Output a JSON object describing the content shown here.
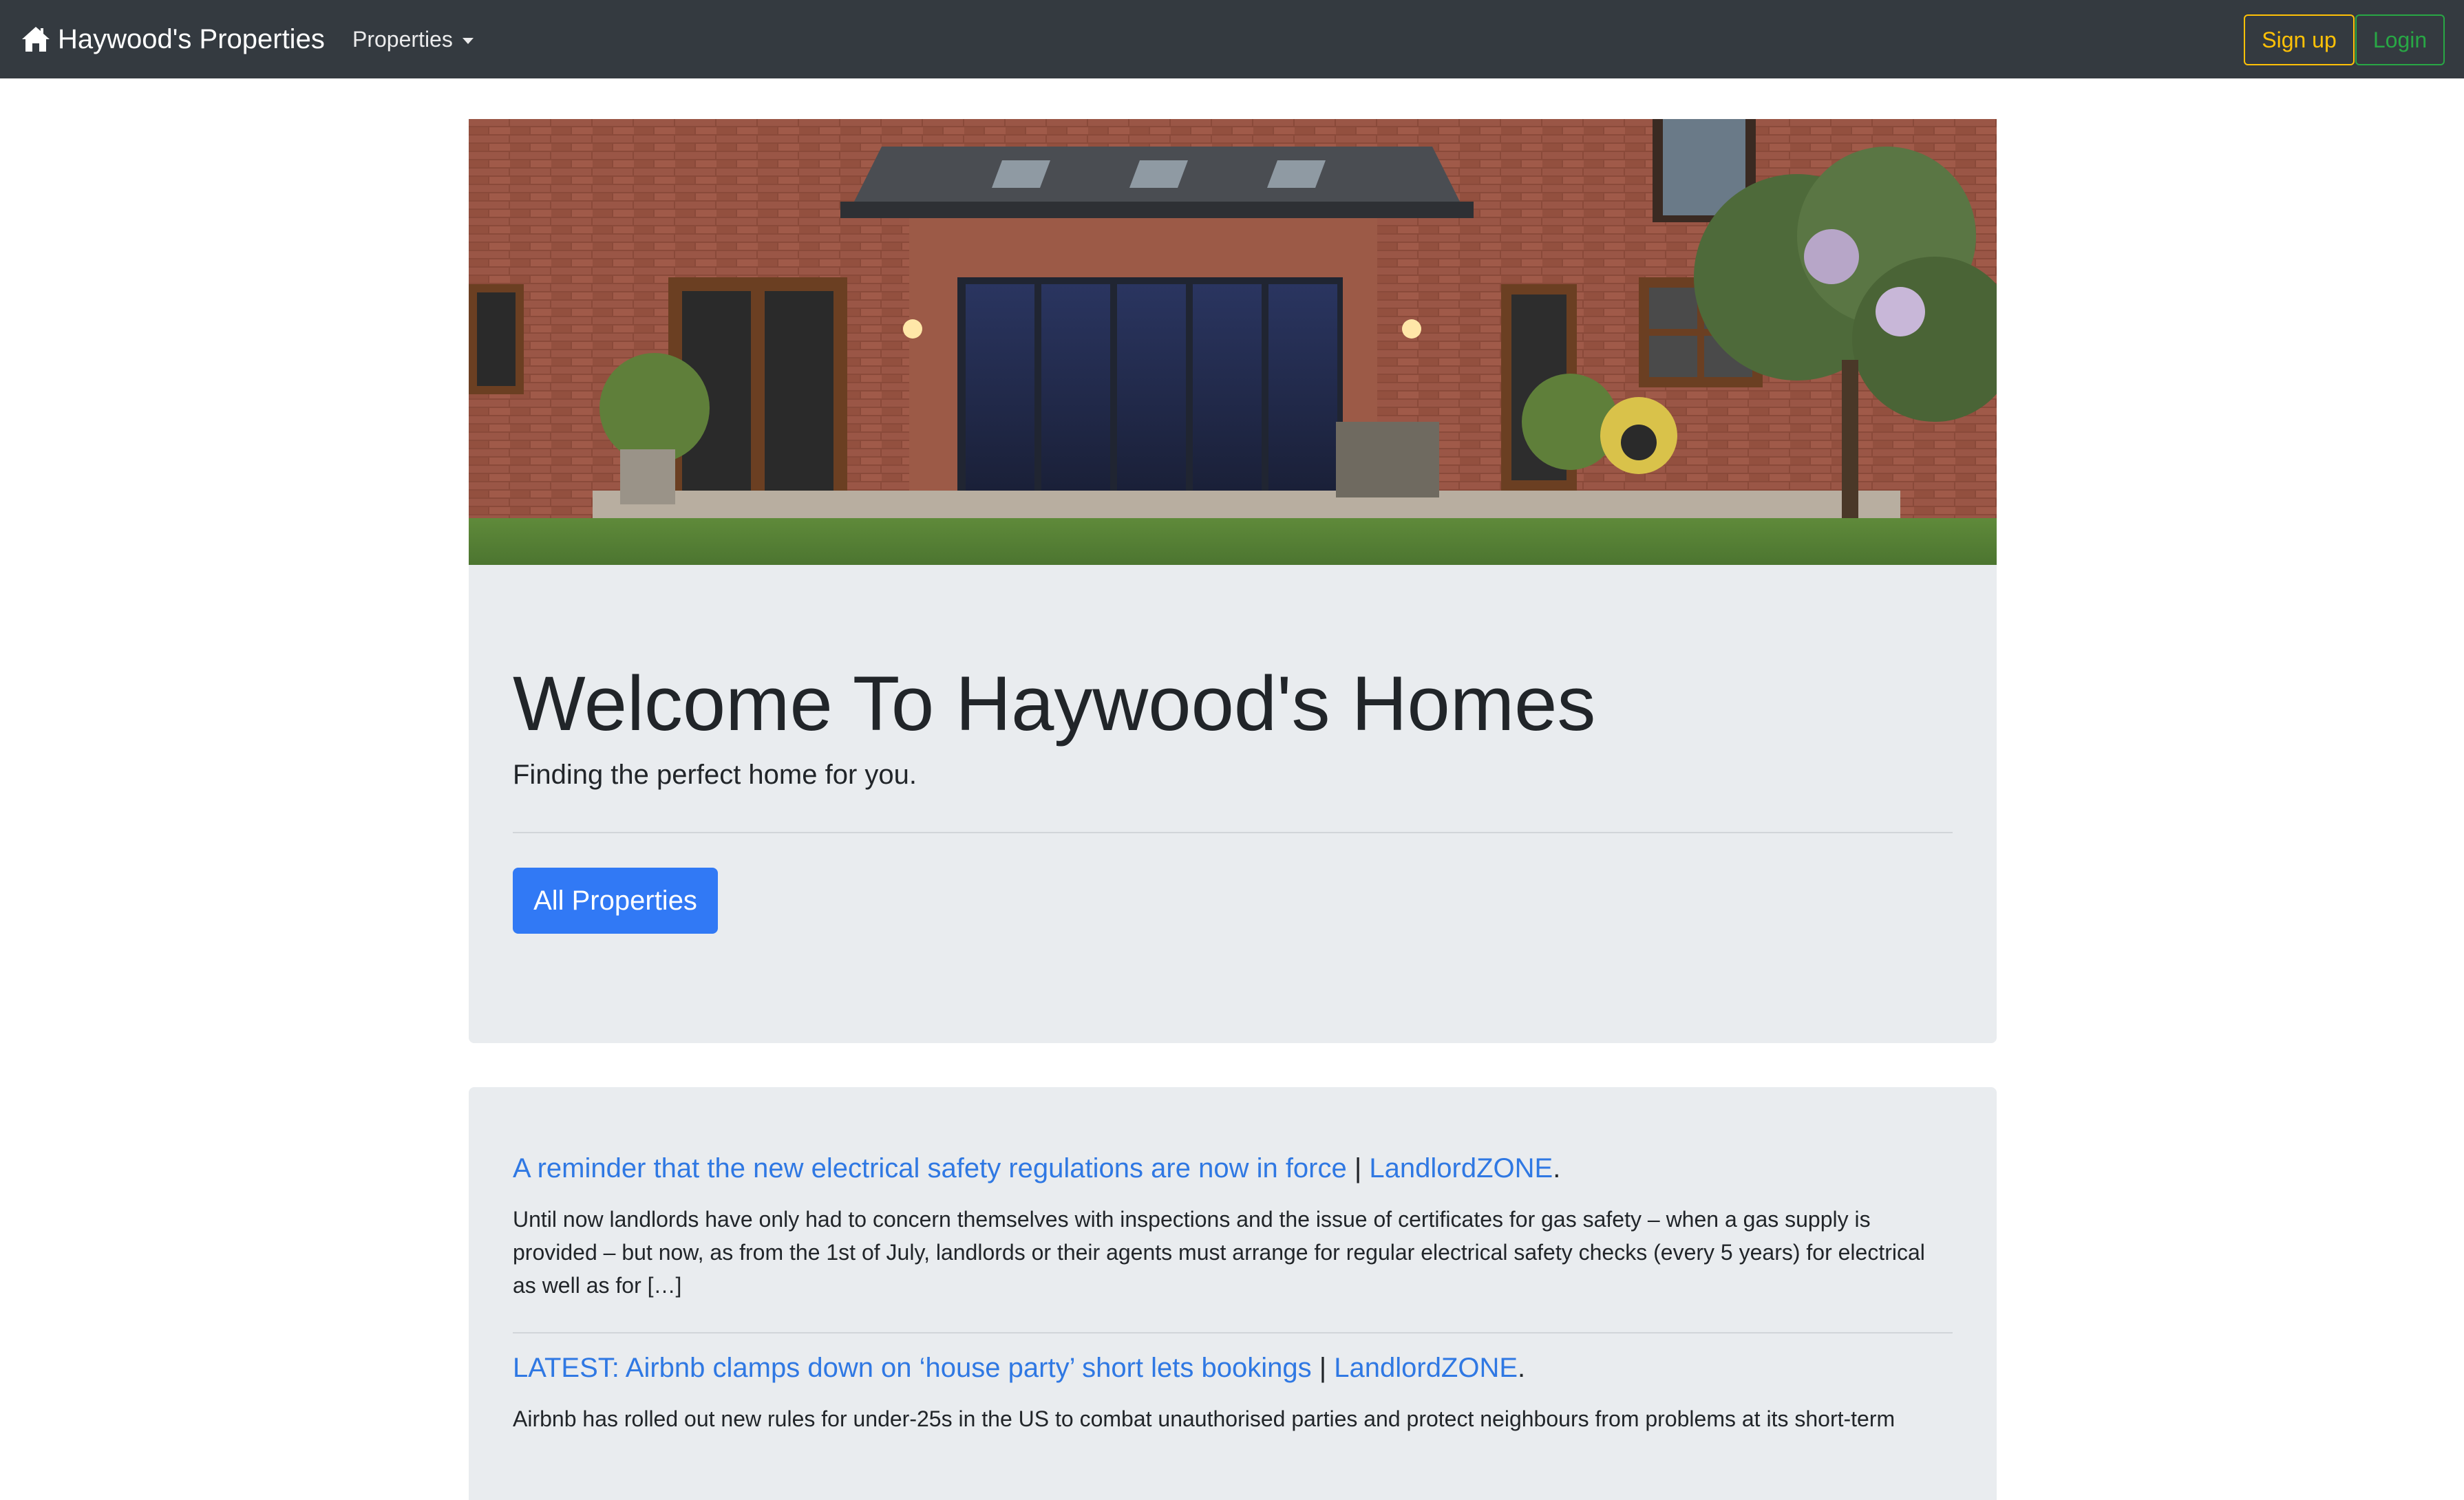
{
  "navbar": {
    "brand_icon": "home-icon",
    "brand_label": "Haywood's Properties",
    "properties_label": "Properties",
    "signup_label": "Sign up",
    "login_label": "Login",
    "colors": {
      "background": "#343a40",
      "signup": "#ffc107",
      "login": "#28a745"
    }
  },
  "hero": {
    "image_subject": "brick house rear exterior with glass doors, patio and garden",
    "title": "Welcome To Haywood's Homes",
    "lead": "Finding the perfect home for you.",
    "button_label": "All Properties",
    "button_color": "#3179f5"
  },
  "news": [
    {
      "title": "A reminder that the new electrical safety regulations are now in force",
      "separator": "|",
      "source": "LandlordZONE",
      "end": ".",
      "excerpt": "Until now landlords have only had to concern themselves with inspections and the issue of certificates for gas safety – when a gas supply is provided – but now, as from the 1st of July, landlords or their agents must arrange for regular electrical safety checks (every 5 years) for electrical as well as for […]"
    },
    {
      "title": "LATEST: Airbnb clamps down on ‘house party’ short lets bookings",
      "separator": "|",
      "source": "LandlordZONE",
      "end": ".",
      "excerpt": "Airbnb has rolled out new rules for under-25s in the US to combat unauthorised parties and protect neighbours from problems at its short-term"
    }
  ]
}
